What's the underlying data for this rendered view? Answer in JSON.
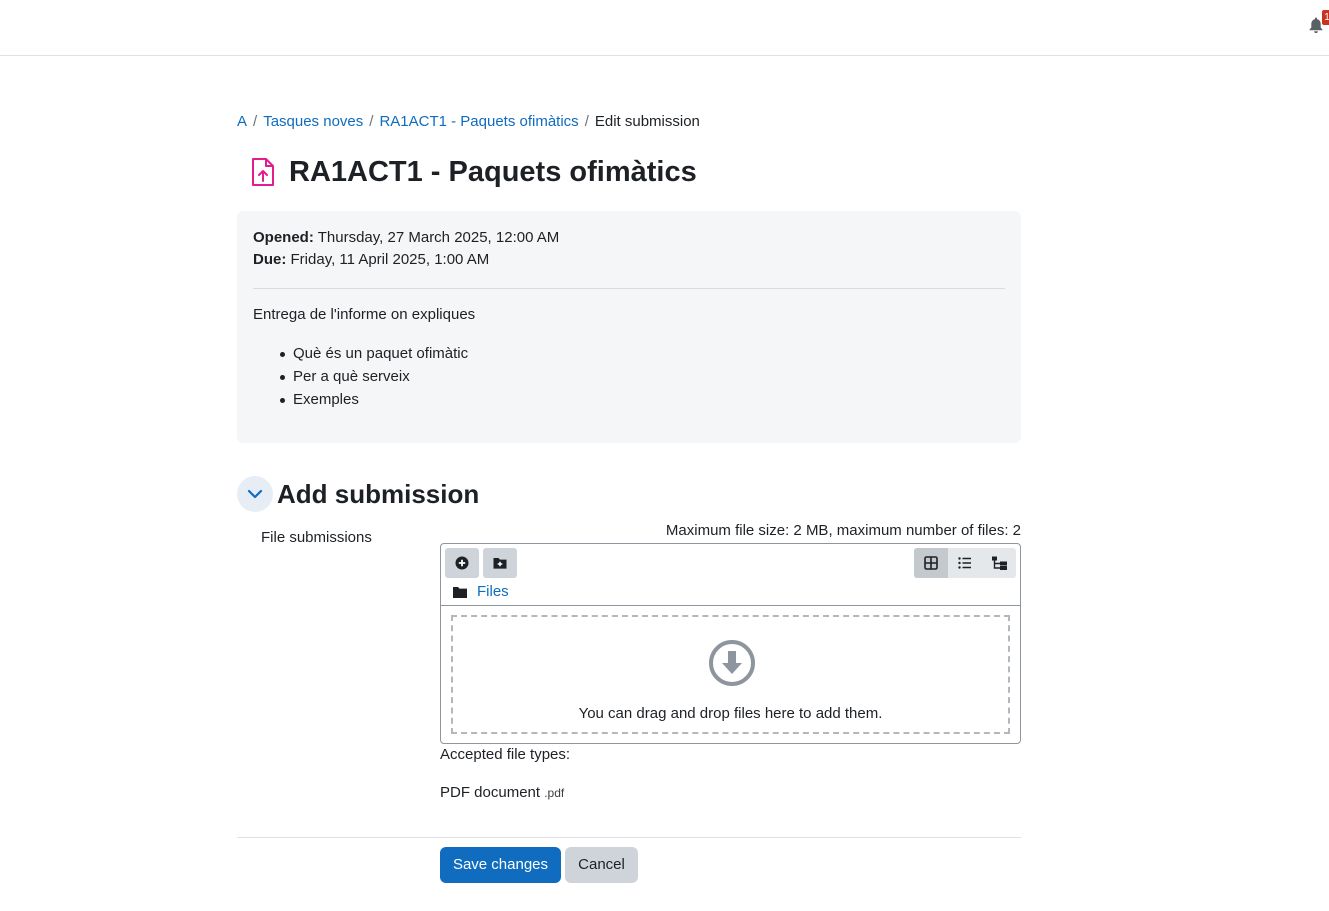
{
  "colors": {
    "accent": "#0f6cbf",
    "assignment_icon": "#e31c8f",
    "secondary_button": "#ced4da",
    "notification_badge": "#ca3120"
  },
  "header": {
    "notification_icon": "bell-icon",
    "notification_count": "1"
  },
  "breadcrumb": {
    "items": [
      "A",
      "Tasques noves",
      "RA1ACT1 - Paquets ofimàtics"
    ],
    "current": "Edit submission"
  },
  "page": {
    "icon": "assignment-upload-icon",
    "title": "RA1ACT1 - Paquets ofimàtics"
  },
  "activity": {
    "opened_label": "Opened:",
    "opened_value": "Thursday, 27 March 2025, 12:00 AM",
    "due_label": "Due:",
    "due_value": "Friday, 11 April 2025, 1:00 AM",
    "intro": "Entrega de l'informe on expliques",
    "bullets": [
      "Què és un paquet ofimàtic",
      "Per a què serveix",
      "Exemples"
    ]
  },
  "submission": {
    "section_title": "Add submission",
    "field_label": "File submissions",
    "limits": "Maximum file size: 2 MB, maximum number of files: 2",
    "toolbar_icons": [
      "add-file-icon",
      "create-folder-icon",
      "grid-view-icon",
      "list-view-icon",
      "tree-view-icon"
    ],
    "folder_path": "Files",
    "drop_text": "You can drag and drop files here to add them.",
    "accepted_label": "Accepted file types:",
    "file_type_name": "PDF document",
    "file_type_ext": ".pdf"
  },
  "actions": {
    "save": "Save changes",
    "cancel": "Cancel"
  }
}
